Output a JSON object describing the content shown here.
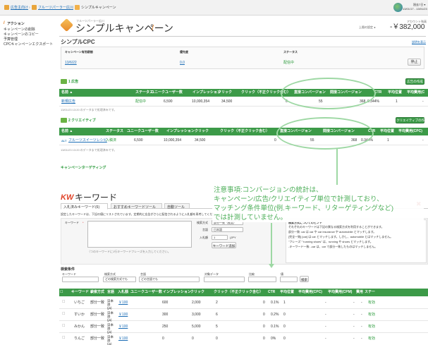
{
  "topbar": {
    "breadcrumb": [
      "広告主向け",
      "フルーツパーラー広川",
      "シンプルキャンペーン"
    ],
    "date_range": "過去7日 ▾",
    "date_sub": "13/01/17 - 13/01/23"
  },
  "sidebar": {
    "heading": "アクション",
    "items": [
      "キャンペーンの削除",
      "キャンペーンのコピー",
      "予算管理",
      "CPCキャンペーンエクスポート"
    ]
  },
  "header": {
    "subtitle": "フルーツパーラー広川",
    "title": "シンプルキャンペーン",
    "status_label": "上限の設定 ◂",
    "account_label": "アカウント残高",
    "account_value": "-￥382,000"
  },
  "cpc": {
    "title": "シンプルCPC",
    "help": "説明を表示",
    "col_period": "キャンペーン有効期間",
    "col_priority": "優先度",
    "col_status": "ステータス",
    "period": "13/6/22",
    "priority": "0.0",
    "status": "配信中",
    "stop": "停止"
  },
  "ads": {
    "count_label": "1 広告",
    "create": "広告の作成",
    "headers": [
      "名前 ▲",
      "ステータス",
      "ユニークユーザー数",
      "インプレッション",
      "クリック",
      "クリック（不正クリック含む）",
      "直接コンバージョン",
      "間接コンバージョン",
      "CTR",
      "平均位置",
      "平均費用(C"
    ],
    "row": [
      "新規広告",
      "配信中",
      "6,590",
      "10,000,354",
      "34,500",
      "0",
      "55",
      "368",
      "0.344%",
      "1",
      "-"
    ],
    "note": "13/01/23 13:20 のデータまで処理済みです。"
  },
  "creatives": {
    "count_label": "2 クリエイティブ",
    "create": "クリエイティブの作成",
    "headers": [
      "名前 ▲",
      "ステータス",
      "ユニークユーザー数",
      "インプレッション",
      "クリック",
      "クリック（不正クリック含む）",
      "直接コンバージョン",
      "間接コンバージョン",
      "CTR",
      "平均位置",
      "平均費用(CPC)"
    ],
    "row": [
      "フルーツスイーツレシピ",
      "入稿済",
      "6,590",
      "10,000,354",
      "34,500",
      "0",
      "55",
      "368",
      "0.344%",
      "1",
      "-"
    ],
    "row_icon": "ALT",
    "note": "13/01/23 13:20 のデータまで処理済みです。"
  },
  "targeting_title": "キャンペーンターゲティング",
  "annotation": [
    "注意事項:コンバージョンの統計は、",
    "キャンペーン/広告/クリエイティブ単位で計測しており、",
    "マッチング条件単位(例.キーワード、リターゲティングなど)",
    "では計測していません。"
  ],
  "keyword": {
    "logo": "KW",
    "title": "キーワード",
    "close": "✖",
    "tabs": [
      "入札済みキーワード(6)",
      "おすすめキーワードツール",
      "自動ツール"
    ],
    "desc": "設定したキーワードは、下記の値にリストされています。定期的に広告がさらに配信されるように入札額を再考してください。",
    "form_label": "キーワード",
    "textarea_hint": "（つのキーワードに1行キーワードフレーズを入力してください。",
    "match_label": "検索方式",
    "match_value": "部分一致（推奨）",
    "lang_label": "言語",
    "lang_value": "日本語",
    "bid_label": "入札額",
    "bid_value": "1",
    "bid_unit": "(JPY",
    "add_button": "キーワード追加",
    "hint_title": "検索方式についてのヒント",
    "hint_lines": [
      "それぞれのキーワードは下記の異なる検索方式を利用することができます。",
      "部分一致: car は car や car insurance や automobile とマッチします。",
      "[完全一致] [car] は car とマッチします。しかし、automobile とはマッチしません。",
      "\"フレーズ\" \"running shoes\" は、running や shoes とマッチします。",
      "-キーワード一致: -car は、car で部分一致したものはマッチしません。"
    ]
  },
  "filter": {
    "title": "検索条件",
    "labels": [
      "キーワード",
      "検索方式",
      "言語",
      "対象データ",
      "比較",
      "値"
    ],
    "match_value": "どの検索方式でも",
    "lang_value": "どの言語でも",
    "search": "検索"
  },
  "kw_table": {
    "headers": [
      "キーワード ▲",
      "検索方式",
      "言語",
      "入札額",
      "ユニークユーザー数",
      "インプレッション",
      "クリック",
      "クリック（不正クリック含む）",
      "CTR",
      "平均位置",
      "平均費用(CPC)",
      "平均費用(CPM)",
      "費用",
      "ステー"
    ],
    "rows": [
      [
        "いちご",
        "部分一致",
        "日本語 (ja)",
        "￥100",
        "600",
        "2,000",
        "2",
        "0",
        "0.1%",
        "1",
        "-",
        "-",
        "-",
        "有効"
      ],
      [
        "すいか",
        "部分一致",
        "日本語 (ja)",
        "￥100",
        "300",
        "3,000",
        "6",
        "0",
        "0.2%",
        "0",
        "-",
        "-",
        "-",
        "有効"
      ],
      [
        "みかん",
        "部分一致",
        "日本語 (ja)",
        "￥100",
        "250",
        "5,000",
        "5",
        "0",
        "0.1%",
        "0",
        "-",
        "-",
        "-",
        "有効"
      ],
      [
        "りんご",
        "部分一致",
        "日本語 (ja)",
        "￥100",
        "0",
        "0",
        "0",
        "0",
        "0%",
        "0",
        "-",
        "-",
        "-",
        "有効"
      ]
    ]
  },
  "colors": {
    "green": "#3c9a48",
    "annotation": "#4cae58",
    "link": "#1a6cb5",
    "logo": "#e0452a"
  }
}
